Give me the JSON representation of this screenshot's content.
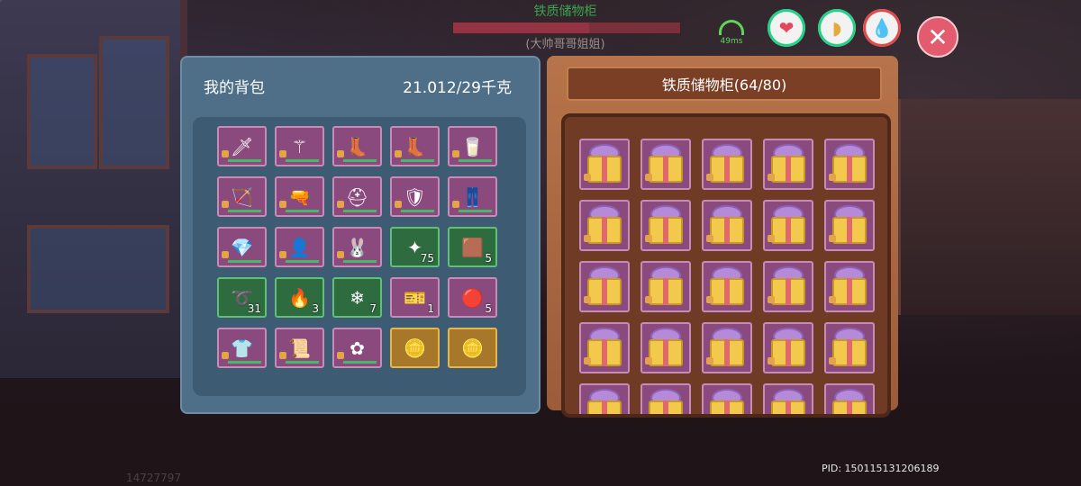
{
  "hud": {
    "target_name": "铁质储物柜",
    "target_subtitle": "(大帅哥哥姐姐)",
    "target_hp_fraction": 0.6,
    "ping": "49ms"
  },
  "bag": {
    "title": "我的背包",
    "weight": "21.012/29千克",
    "slots": [
      {
        "icon": "sword-icon",
        "glyph": "🗡",
        "color": "purple",
        "qty": ""
      },
      {
        "icon": "staff-icon",
        "glyph": "⚚",
        "color": "purple",
        "qty": ""
      },
      {
        "icon": "boot-icon",
        "glyph": "👢",
        "color": "purple",
        "qty": ""
      },
      {
        "icon": "boot-icon",
        "glyph": "👢",
        "color": "purple",
        "qty": ""
      },
      {
        "icon": "glass-icon",
        "glyph": "🥛",
        "color": "purple",
        "qty": ""
      },
      {
        "icon": "bow-icon",
        "glyph": "🏹",
        "color": "purple",
        "qty": ""
      },
      {
        "icon": "rifle-icon",
        "glyph": "🔫",
        "color": "purple",
        "qty": ""
      },
      {
        "icon": "helmet-icon",
        "glyph": "⛑",
        "color": "purple",
        "qty": ""
      },
      {
        "icon": "armor-icon",
        "glyph": "🛡",
        "color": "purple",
        "qty": ""
      },
      {
        "icon": "pants-icon",
        "glyph": "👖",
        "color": "purple",
        "qty": ""
      },
      {
        "icon": "gem-icon",
        "glyph": "💎",
        "color": "purple",
        "qty": ""
      },
      {
        "icon": "hair-icon",
        "glyph": "👤",
        "color": "purple",
        "qty": ""
      },
      {
        "icon": "rabbit-ears-icon",
        "glyph": "🐰",
        "color": "purple",
        "qty": ""
      },
      {
        "icon": "orb-icon",
        "glyph": "✦",
        "color": "green",
        "qty": "75"
      },
      {
        "icon": "leather-icon",
        "glyph": "🟫",
        "color": "green",
        "qty": "5"
      },
      {
        "icon": "rope-icon",
        "glyph": "➰",
        "color": "green",
        "qty": "31"
      },
      {
        "icon": "fire-icon",
        "glyph": "🔥",
        "color": "green",
        "qty": "3"
      },
      {
        "icon": "crystal-icon",
        "glyph": "❄",
        "color": "green",
        "qty": "7"
      },
      {
        "icon": "ticket-icon",
        "glyph": "🎫",
        "color": "purple",
        "qty": "1"
      },
      {
        "icon": "coin-icon",
        "glyph": "🔴",
        "color": "purple",
        "qty": "5"
      },
      {
        "icon": "shirt-icon",
        "glyph": "👕",
        "color": "purple",
        "qty": ""
      },
      {
        "icon": "scroll-icon",
        "glyph": "📜",
        "color": "purple",
        "qty": ""
      },
      {
        "icon": "pinwheel-icon",
        "glyph": "✿",
        "color": "purple",
        "qty": ""
      },
      {
        "icon": "gold-coin-icon",
        "glyph": "🪙",
        "color": "gold",
        "qty": ""
      },
      {
        "icon": "gold-coin-icon",
        "glyph": "🪙",
        "color": "gold",
        "qty": ""
      }
    ]
  },
  "cabinet": {
    "title": "铁质储物柜(64/80)",
    "item_icon": "gift-box-icon"
  },
  "footer": {
    "left_id": "14727797",
    "pid": "PID: 150115131206189"
  }
}
